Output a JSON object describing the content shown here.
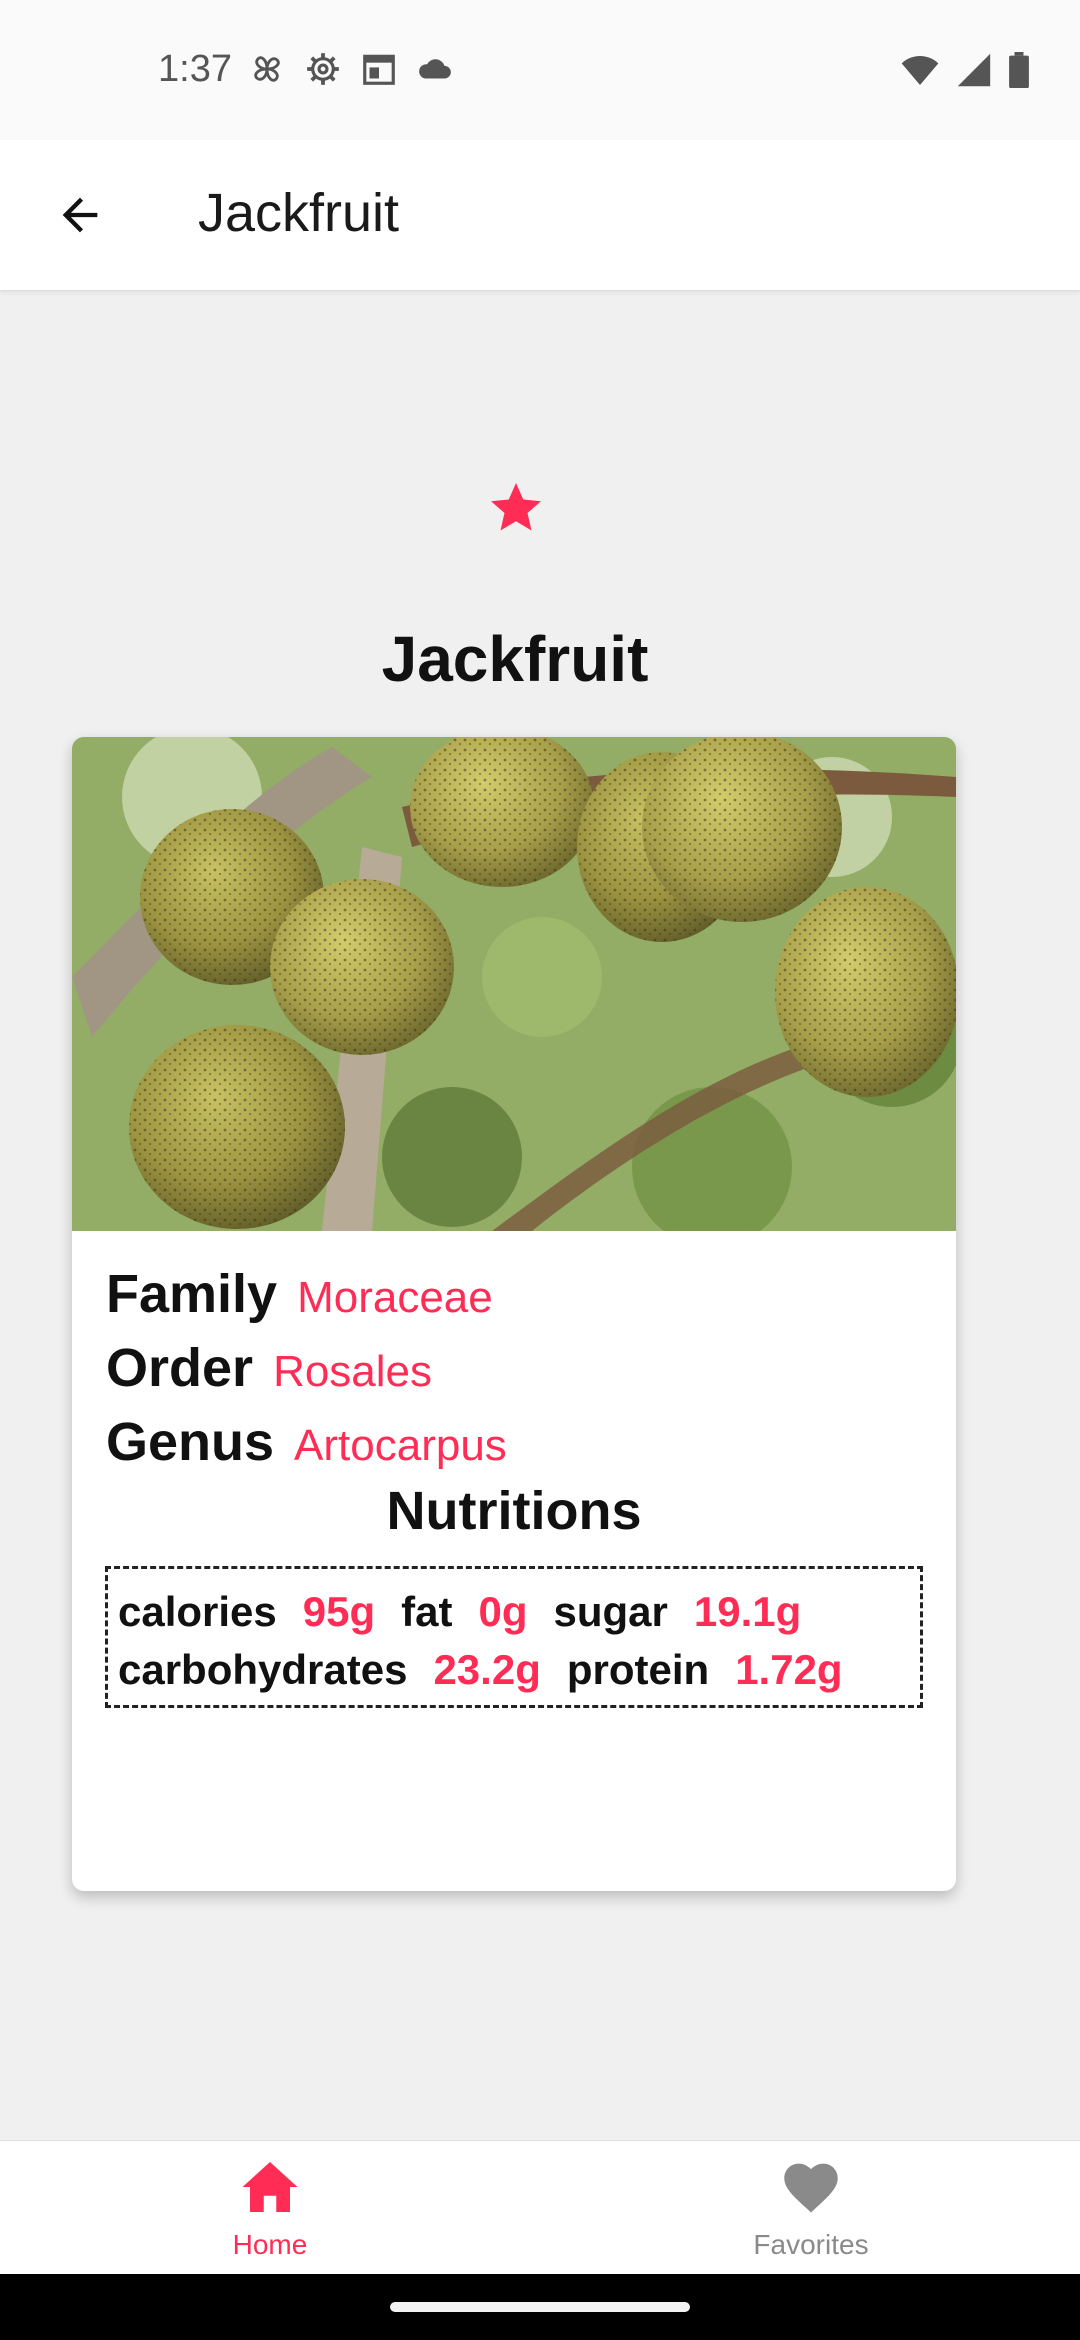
{
  "status": {
    "time": "1:37",
    "left_icons": [
      "pinwheel-icon",
      "gear-icon",
      "calendar-icon",
      "cloud-icon"
    ],
    "right_icons": [
      "wifi-icon",
      "signal-icon",
      "battery-icon"
    ]
  },
  "app_bar": {
    "back_icon": "arrow-left-icon",
    "title": "Jackfruit"
  },
  "favorite": {
    "icon": "star-icon",
    "color": "#ff2d55",
    "active": true
  },
  "fruit": {
    "name": "Jackfruit",
    "family_label": "Family",
    "family": "Moraceae",
    "order_label": "Order",
    "order": "Rosales",
    "genus_label": "Genus",
    "genus": "Artocarpus"
  },
  "nutrition": {
    "title": "Nutritions",
    "calories_label": "calories",
    "calories": "95g",
    "fat_label": "fat",
    "fat": "0g",
    "sugar_label": "sugar",
    "sugar": "19.1g",
    "carbohydrates_label": "carbohydrates",
    "carbohydrates": "23.2g",
    "protein_label": "protein",
    "protein": "1.72g"
  },
  "bottom_nav": {
    "items": [
      {
        "label": "Home",
        "icon": "home-icon",
        "active": true
      },
      {
        "label": "Favorites",
        "icon": "heart-icon",
        "active": false
      }
    ]
  },
  "colors": {
    "accent": "#ff2d55",
    "inactive": "#8a8a8a",
    "background": "#f0f0f0"
  }
}
